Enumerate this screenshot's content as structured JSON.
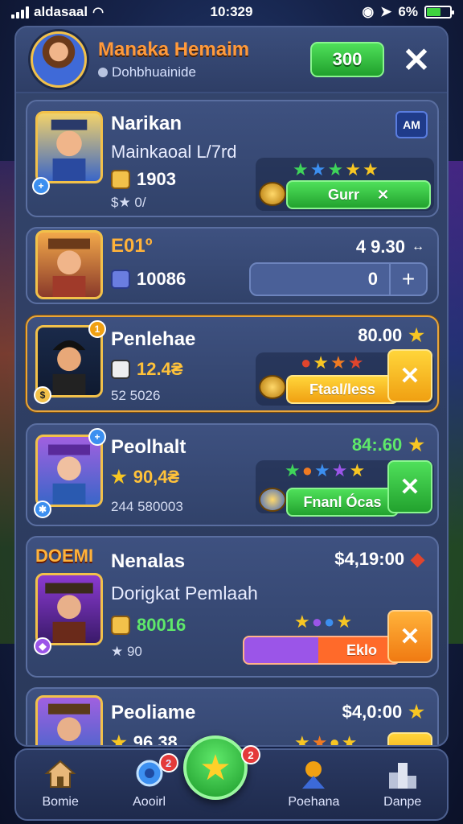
{
  "status_bar": {
    "carrier": "aldasaal",
    "time": "10:329",
    "battery": "6%",
    "battery_level": 0.6
  },
  "header": {
    "title": "Manaka Hemaim",
    "subtitle": "Dohbhuainide",
    "coins": "300"
  },
  "cards": [
    {
      "name": "Narikan",
      "subtitle": "Mainkaoal L/7rd",
      "value": "1903",
      "small": "$★ 0/",
      "badge": "AM",
      "action": "Gurr"
    },
    {
      "name": "E01º",
      "value": "10086",
      "price": "4 9.30",
      "stepper_value": "0"
    },
    {
      "name": "Penlehae",
      "value": "12.4₴",
      "small": "52  5026",
      "price": "80.00",
      "action": "Ftaal/less",
      "badge": "1"
    },
    {
      "name": "Peolhalt",
      "value": "90,4₴",
      "small": "244  580003",
      "price": "84:.60",
      "action": "Fnanl Ócas"
    },
    {
      "name": "Nenalas",
      "tag": "DOEMI",
      "subtitle": "Dorigkat Pemlaah",
      "value": "80016",
      "small": "★ 90",
      "price": "$4,19:00",
      "action": "Eklo"
    },
    {
      "name": "Peoliame",
      "value": "96 38",
      "price": "$4,0:00"
    }
  ],
  "nav": {
    "items": [
      {
        "label": "Bomie",
        "icon": "home-icon"
      },
      {
        "label": "Aooirl",
        "icon": "chat-icon",
        "badge": "2"
      },
      {
        "label": "Poehana",
        "icon": "character-icon"
      },
      {
        "label": "Danpe",
        "icon": "podium-icon"
      }
    ],
    "center_icon": "star-icon",
    "center_badge": "2"
  },
  "colors": {
    "accent_orange": "#ff9a3c",
    "green": "#22a22e",
    "yellow": "#f0a012",
    "panel": "#34456d"
  }
}
